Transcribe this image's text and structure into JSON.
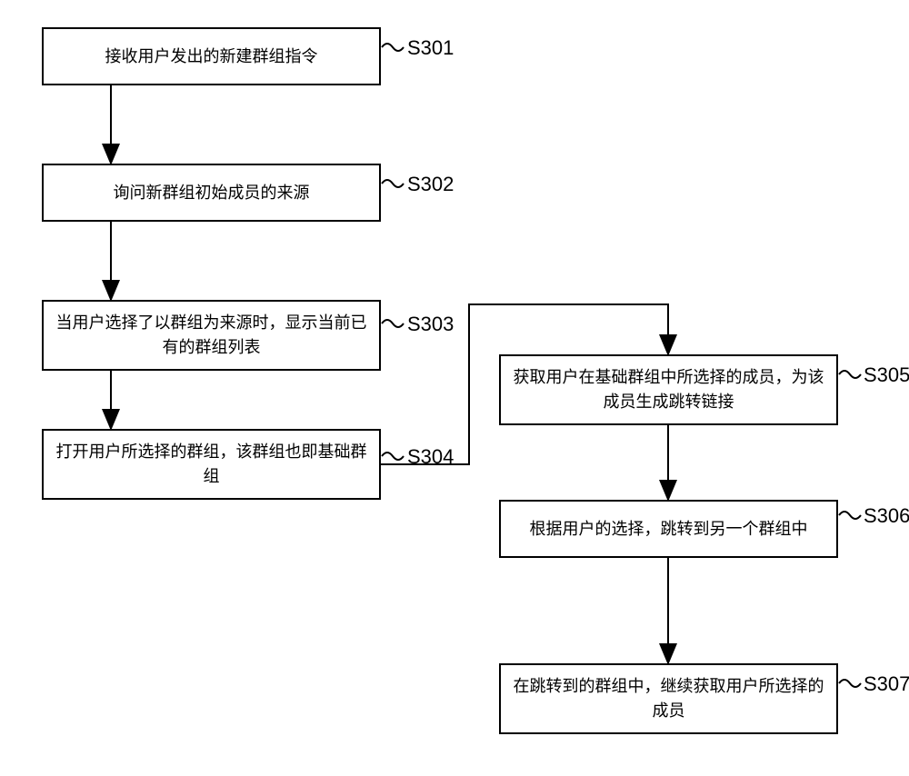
{
  "steps": {
    "s301": {
      "text": "接收用户发出的新建群组指令",
      "tag": "S301"
    },
    "s302": {
      "text": "询问新群组初始成员的来源",
      "tag": "S302"
    },
    "s303": {
      "text": "当用户选择了以群组为来源时，显示当前已有的群组列表",
      "tag": "S303"
    },
    "s304": {
      "text": "打开用户所选择的群组，该群组也即基础群组",
      "tag": "S304"
    },
    "s305": {
      "text": "获取用户在基础群组中所选择的成员，为该成员生成跳转链接",
      "tag": "S305"
    },
    "s306": {
      "text": "根据用户的选择，跳转到另一个群组中",
      "tag": "S306"
    },
    "s307": {
      "text": "在跳转到的群组中，继续获取用户所选择的成员",
      "tag": "S307"
    }
  }
}
